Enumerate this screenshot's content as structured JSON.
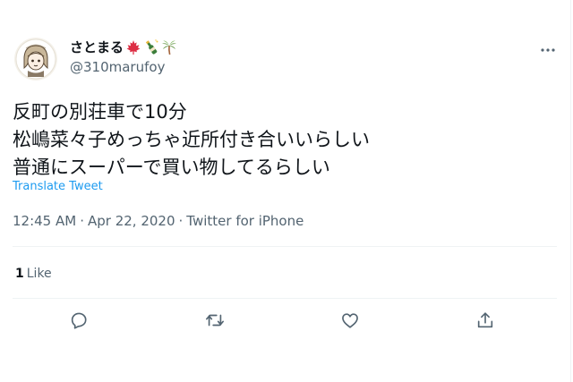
{
  "user": {
    "display_name": "さとまる",
    "name_emoji_icons": [
      "maple-leaf-icon",
      "champagne-bottle-icon",
      "palm-tree-icon"
    ],
    "handle": "@310marufoy"
  },
  "tweet": {
    "lines": [
      "反町の別荘車で10分",
      "松嶋菜々子めっちゃ近所付き合いいらしい",
      "普通にスーパーで買い物してるらしい"
    ],
    "translate_label": "Translate Tweet",
    "time": "12:45 AM",
    "separator": "·",
    "date": "Apr 22, 2020",
    "source": "Twitter for iPhone"
  },
  "stats": {
    "like_count": "1",
    "like_label": "Like"
  },
  "actions": [
    "reply-icon",
    "retweet-icon",
    "like-icon",
    "share-icon"
  ],
  "colors": {
    "text": "#0f1419",
    "secondary": "#536471",
    "link": "#1d9bf0",
    "divider": "#eff3f4"
  }
}
